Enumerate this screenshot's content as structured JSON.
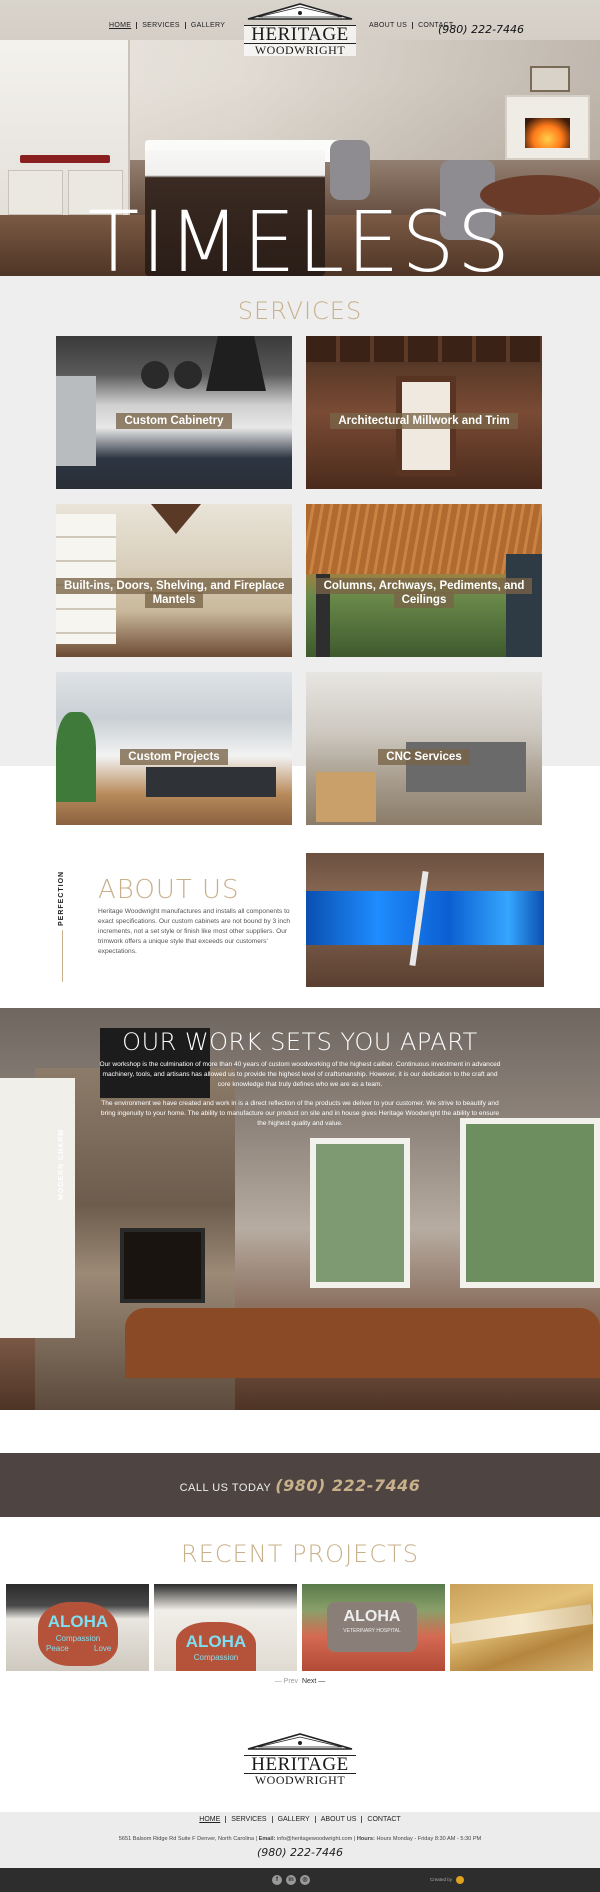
{
  "header": {
    "nav_left": [
      "HOME",
      "SERVICES",
      "GALLERY"
    ],
    "nav_right": [
      "ABOUT US",
      "CONTACT"
    ],
    "phone": "(980) 222-7446",
    "logo_line1": "HERITAGE",
    "logo_line2": "WOODWRIGHT"
  },
  "hero": {
    "headline": "TIMELESS"
  },
  "services": {
    "title": "SERVICES",
    "tiles": [
      {
        "label": "Custom Cabinetry"
      },
      {
        "label": "Architectural Millwork and Trim"
      },
      {
        "label": "Built-ins, Doors, Shelving, and Fireplace Mantels"
      },
      {
        "label": "Columns, Archways, Pediments, and Ceilings"
      },
      {
        "label": "Custom Projects"
      },
      {
        "label": "CNC Services"
      }
    ]
  },
  "about": {
    "side_label": "PERFECTION",
    "title": "ABOUT US",
    "text": "Heritage Woodwright manufactures and installs all components to exact specifications. Our custom cabinets are not bound by 3 inch increments, not a set style or finish like most other suppliers. Our trimwork offers a unique style that exceeds our customers' expectations."
  },
  "work": {
    "side_label": "MODERN CHARM",
    "title": "OUR WORK SETS YOU APART",
    "para1": "Our workshop is the culmination of more than 40 years of custom woodworking of the highest caliber. Continuous investment in advanced machinery, tools, and artisans has allowed us to provide the highest level of craftsmanship. However, it is our dedication to the craft and core knowledge that truly defines who we are as a team.",
    "para2": "The environment we have created and work in is a direct reflection of the products we deliver to your customer. We strive to beautify and bring ingenuity to your home. The ability to manufacture our product on site and in house gives Heritage Woodwright the ability to ensure the highest quality and value."
  },
  "call": {
    "label": "CALL US TODAY",
    "phone": "(980) 222-7446"
  },
  "projects": {
    "title": "RECENT PROJECTS",
    "items": [
      {
        "sign": "ALOHA",
        "sub1": "Compassion",
        "sub2": "Peace",
        "sub3": "Love"
      },
      {
        "sign": "ALOHA",
        "sub1": "Compassion"
      },
      {
        "sign": "ALOHA",
        "sub1": "VETERINARY HOSPITAL"
      },
      {
        "sign": ""
      }
    ],
    "prev": "— Prev",
    "next": "Next —"
  },
  "footer": {
    "nav": [
      "HOME",
      "SERVICES",
      "GALLERY",
      "ABOUT US",
      "CONTACT"
    ],
    "address": "5651 Balsom Ridge Rd Suite F Denver, North Carolina",
    "email_label": "Email:",
    "email": "info@heritagewoodwright.com",
    "hours_label": "Hours:",
    "hours": "Hours Monday - Friday 8:30 AM - 5:30 PM",
    "phone": "(980) 222-7446",
    "social": [
      "f",
      "in",
      "◎"
    ],
    "credit": "Created by"
  },
  "colors": {
    "accent": "#c8b08a",
    "dark_band": "#4e4543",
    "footer_bar": "#2d2d2d"
  }
}
